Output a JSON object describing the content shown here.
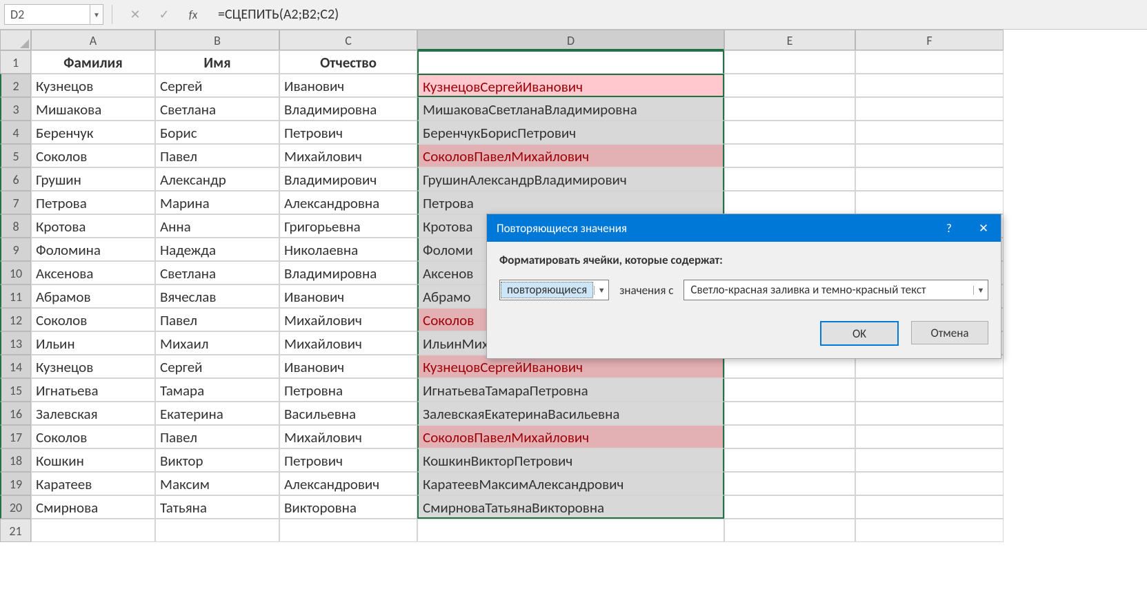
{
  "nameBox": "D2",
  "formula": "=СЦЕПИТЬ(A2;B2;C2)",
  "colHeaders": [
    "A",
    "B",
    "C",
    "D",
    "E",
    "F"
  ],
  "headerRow": {
    "A": "Фамилия",
    "B": "Имя",
    "C": "Отчество",
    "D": ""
  },
  "rows": [
    {
      "n": 2,
      "A": "Кузнецов",
      "B": "Сергей",
      "C": "Иванович",
      "D": "КузнецовСергейИванович",
      "dup": true,
      "active": true
    },
    {
      "n": 3,
      "A": "Мишакова",
      "B": "Светлана",
      "C": "Владимировна",
      "D": "МишаковаСветланаВладимировна"
    },
    {
      "n": 4,
      "A": "Беренчук",
      "B": "Борис",
      "C": "Петрович",
      "D": "БеренчукБорисПетрович"
    },
    {
      "n": 5,
      "A": "Соколов",
      "B": "Павел",
      "C": "Михайлович",
      "D": "СоколовПавелМихайлович",
      "dup": true
    },
    {
      "n": 6,
      "A": "Грушин",
      "B": "Александр",
      "C": "Владимирович",
      "D": "ГрушинАлександрВладимирович"
    },
    {
      "n": 7,
      "A": "Петрова",
      "B": "Марина",
      "C": "Александровна",
      "D": "Петрова"
    },
    {
      "n": 8,
      "A": "Кротова",
      "B": "Анна",
      "C": "Григорьевна",
      "D": "Кротова"
    },
    {
      "n": 9,
      "A": "Фоломина",
      "B": "Надежда",
      "C": "Николаевна",
      "D": "Фоломи"
    },
    {
      "n": 10,
      "A": "Аксенова",
      "B": "Светлана",
      "C": "Владимировна",
      "D": "Аксенов"
    },
    {
      "n": 11,
      "A": "Абрамов",
      "B": "Вячеслав",
      "C": "Иванович",
      "D": "Абрамо"
    },
    {
      "n": 12,
      "A": "Соколов",
      "B": "Павел",
      "C": "Михайлович",
      "D": "Соколов",
      "dup": true
    },
    {
      "n": 13,
      "A": "Ильин",
      "B": "Михаил",
      "C": "Михайлович",
      "D": "ИльинМихаилМихайлович"
    },
    {
      "n": 14,
      "A": "Кузнецов",
      "B": "Сергей",
      "C": "Иванович",
      "D": "КузнецовСергейИванович",
      "dup": true
    },
    {
      "n": 15,
      "A": "Игнатьева",
      "B": "Тамара",
      "C": "Петровна",
      "D": "ИгнатьеваТамараПетровна"
    },
    {
      "n": 16,
      "A": "Залевская",
      "B": "Екатерина",
      "C": "Васильевна",
      "D": "ЗалевскаяЕкатеринаВасильевна"
    },
    {
      "n": 17,
      "A": "Соколов",
      "B": "Павел",
      "C": "Михайлович",
      "D": "СоколовПавелМихайлович",
      "dup": true
    },
    {
      "n": 18,
      "A": "Кошкин",
      "B": "Виктор",
      "C": "Петрович",
      "D": "КошкинВикторПетрович"
    },
    {
      "n": 19,
      "A": "Каратеев",
      "B": "Максим",
      "C": "Александрович",
      "D": "КаратеевМаксимАлександрович"
    },
    {
      "n": 20,
      "A": "Смирнова",
      "B": "Татьяна",
      "C": "Викторовна",
      "D": "СмирноваТатьянаВикторовна"
    }
  ],
  "extraRow": 21,
  "dialog": {
    "title": "Повторяющиеся значения",
    "help": "?",
    "close": "✕",
    "subtitle": "Форматировать ячейки, которые содержат:",
    "select1": "повторяющиеся",
    "label_mid": "значения с",
    "select2": "Светло-красная заливка и темно-красный текст",
    "ok": "OK",
    "cancel": "Отмена"
  }
}
